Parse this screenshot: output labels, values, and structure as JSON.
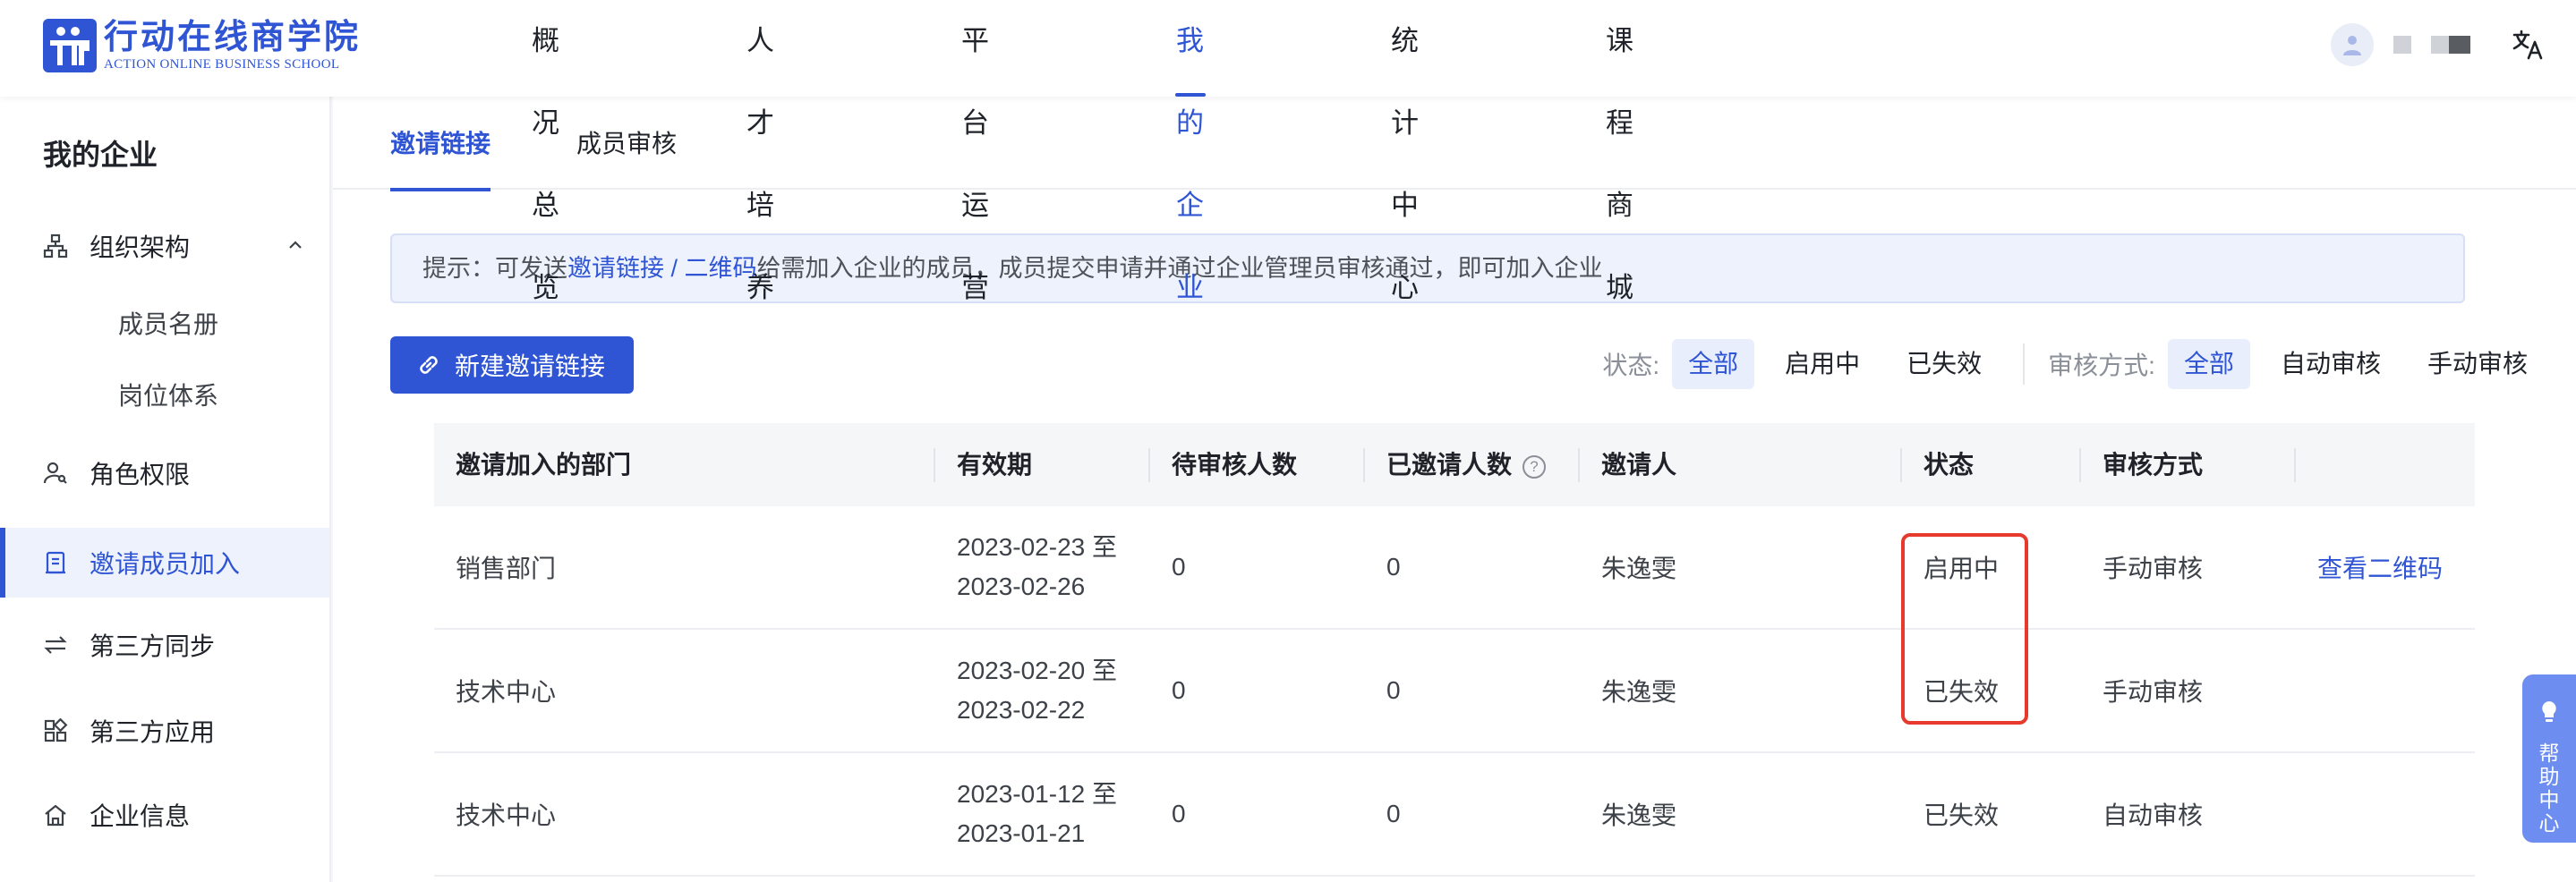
{
  "brand": {
    "name_cn": "行动在线商学院",
    "name_en": "ACTION ONLINE BUSINESS SCHOOL",
    "color": "#2f55d4"
  },
  "nav": {
    "items": [
      {
        "label": "概况总览"
      },
      {
        "label": "人才培养"
      },
      {
        "label": "平台运营"
      },
      {
        "label": "我的企业",
        "active": true
      },
      {
        "label": "统计中心"
      },
      {
        "label": "课程商城"
      }
    ]
  },
  "header_icons": {
    "avatar": "user-avatar-icon",
    "language": "translate-icon"
  },
  "sidebar": {
    "title": "我的企业",
    "items": [
      {
        "label": "组织架构",
        "icon": "org-chart-icon",
        "expanded": true
      },
      {
        "label": "成员名册",
        "sub": true
      },
      {
        "label": "岗位体系",
        "sub": true
      },
      {
        "label": "角色权限",
        "icon": "user-key-icon"
      },
      {
        "label": "邀请成员加入",
        "icon": "invite-doc-icon",
        "active": true
      },
      {
        "label": "第三方同步",
        "icon": "sync-arrows-icon"
      },
      {
        "label": "第三方应用",
        "icon": "apps-grid-icon"
      },
      {
        "label": "企业信息",
        "icon": "home-icon"
      }
    ]
  },
  "tabs": [
    {
      "label": "邀请链接",
      "active": true
    },
    {
      "label": "成员审核"
    }
  ],
  "notice": {
    "prefix": "提示：可发送",
    "link1": "邀请链接",
    "slash": " / ",
    "link2": "二维码",
    "suffix": "给需加入企业的成员，成员提交申请并通过企业管理员审核通过，即可加入企业"
  },
  "toolbar": {
    "new_button": "新建邀请链接",
    "status_label": "状态:",
    "status_options": [
      "全部",
      "启用中",
      "已失效"
    ],
    "review_label": "审核方式:",
    "review_options": [
      "全部",
      "自动审核",
      "手动审核"
    ]
  },
  "table": {
    "columns": [
      "邀请加入的部门",
      "有效期",
      "待审核人数",
      "已邀请人数",
      "邀请人",
      "状态",
      "审核方式",
      ""
    ],
    "rows": [
      {
        "dept": "销售部门",
        "start": "2023-02-23 至",
        "end": "2023-02-26",
        "pending": "0",
        "invited": "0",
        "inviter": "朱逸雯",
        "status": "启用中",
        "review": "手动审核",
        "action": "查看二维码"
      },
      {
        "dept": "技术中心",
        "start": "2023-02-20 至",
        "end": "2023-02-22",
        "pending": "0",
        "invited": "0",
        "inviter": "朱逸雯",
        "status": "已失效",
        "review": "手动审核",
        "action": ""
      },
      {
        "dept": "技术中心",
        "start": "2023-01-12 至",
        "end": "2023-01-21",
        "pending": "0",
        "invited": "0",
        "inviter": "朱逸雯",
        "status": "已失效",
        "review": "自动审核",
        "action": ""
      }
    ]
  },
  "help": {
    "label": "帮助中心",
    "icon": "lightbulb-icon"
  },
  "colors": {
    "accent": "#2f55d4",
    "highlight": "#e8392d",
    "help": "#6d8ef0"
  }
}
